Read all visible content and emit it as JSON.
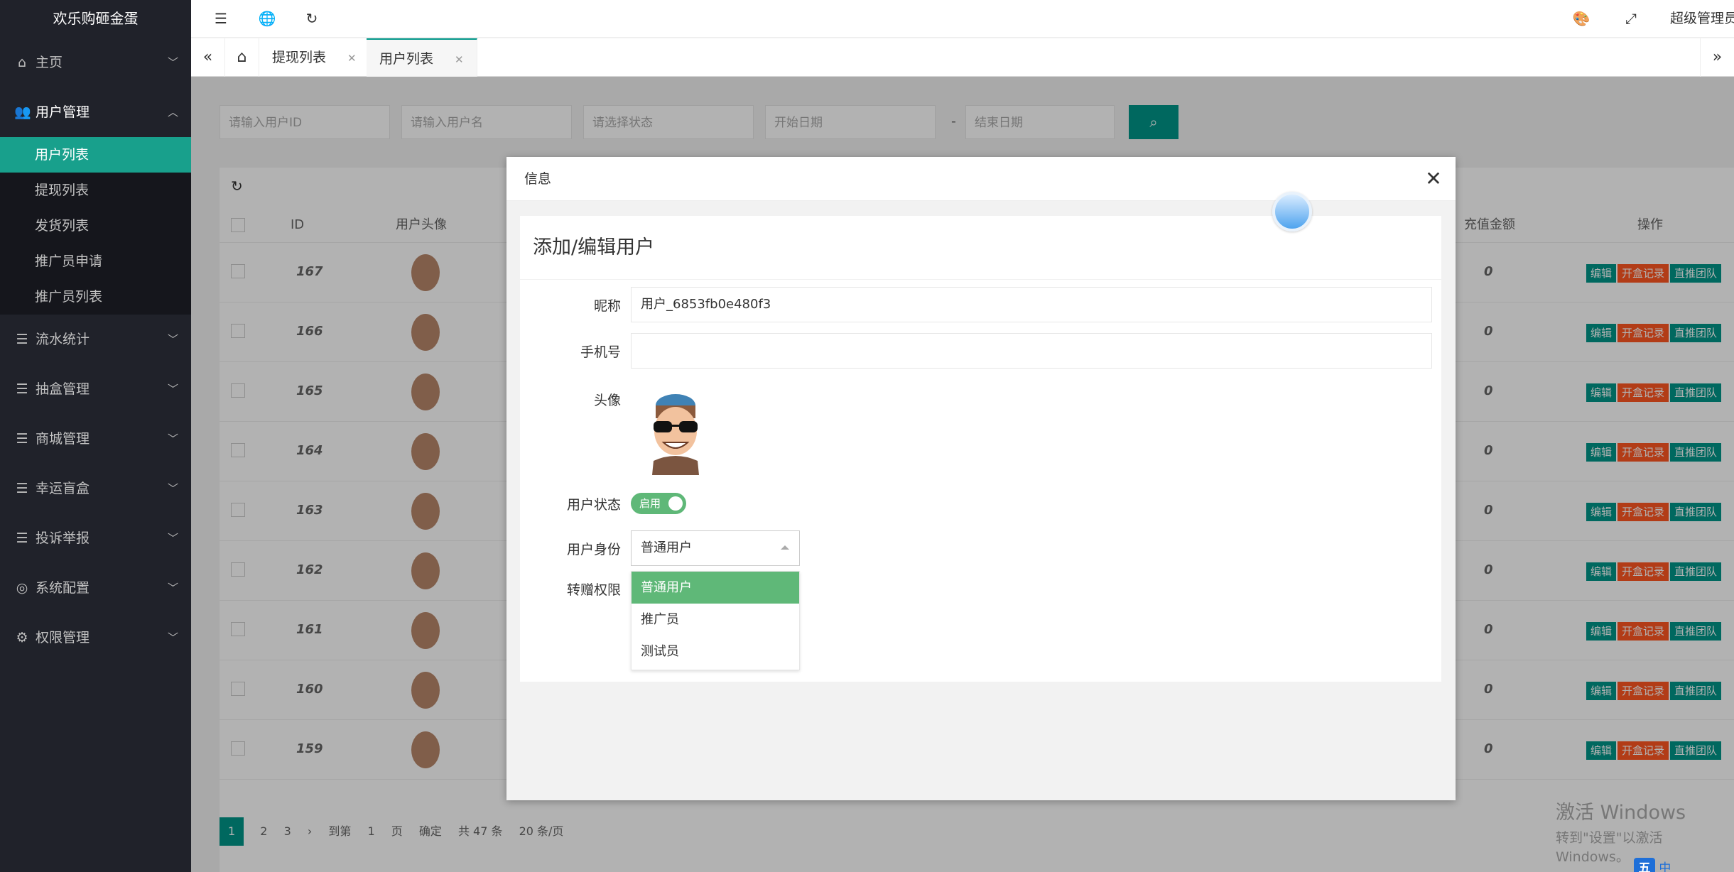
{
  "app": {
    "logo": "欢乐购砸金蛋",
    "admin": "超级管理员"
  },
  "sidebar": {
    "groups": [
      {
        "label": "主页",
        "icon": "home-icon"
      },
      {
        "label": "用户管理",
        "icon": "users-icon"
      },
      {
        "label": "流水统计",
        "icon": "list-icon"
      },
      {
        "label": "抽盒管理",
        "icon": "list-icon"
      },
      {
        "label": "商城管理",
        "icon": "list-icon"
      },
      {
        "label": "幸运盲盒",
        "icon": "list-icon"
      },
      {
        "label": "投诉举报",
        "icon": "list-icon"
      },
      {
        "label": "系统配置",
        "icon": "settings-icon"
      },
      {
        "label": "权限管理",
        "icon": "gear-icon"
      }
    ],
    "sub_items": [
      "用户列表",
      "提现列表",
      "发货列表",
      "推广员申请",
      "推广员列表"
    ]
  },
  "tabs": [
    {
      "label": "提现列表"
    },
    {
      "label": "用户列表"
    }
  ],
  "search": {
    "user_id": "请输入用户ID",
    "user_name": "请输入用户名",
    "status": "请选择状态",
    "start_date": "开始日期",
    "sep": "-",
    "end_date": "结束日期"
  },
  "table": {
    "headers": {
      "id": "ID",
      "avatar": "用户头像",
      "amount": "充值金额",
      "ops": "操作"
    },
    "rows": [
      {
        "id": "167",
        "amount": "0"
      },
      {
        "id": "166",
        "amount": "0"
      },
      {
        "id": "165",
        "amount": "0"
      },
      {
        "id": "164",
        "amount": "0"
      },
      {
        "id": "163",
        "amount": "0"
      },
      {
        "id": "162",
        "amount": "0"
      },
      {
        "id": "161",
        "amount": "0"
      },
      {
        "id": "160",
        "amount": "0"
      },
      {
        "id": "159",
        "amount": "0"
      }
    ],
    "op_labels": {
      "edit": "编辑",
      "records": "开盒记录",
      "team": "直推团队"
    }
  },
  "pager": {
    "p1": "1",
    "p2": "2",
    "p3": "3",
    "goto": "到第",
    "page_input": "1",
    "page_unit": "页",
    "confirm": "确定",
    "total": "共 47 条",
    "size": "20 条/页"
  },
  "modal": {
    "title": "信息",
    "form_title": "添加/编辑用户",
    "fields": {
      "nickname_label": "昵称",
      "nickname_value": "用户_6853fb0e480f3",
      "phone_label": "手机号",
      "phone_value": "",
      "avatar_label": "头像",
      "status_label": "用户状态",
      "status_value": "启用",
      "identity_label": "用户身份",
      "identity_value": "普通用户",
      "transfer_label": "转赠权限"
    },
    "identity_options": [
      "普通用户",
      "推广员",
      "测试员"
    ]
  },
  "watermark": {
    "line1": "激活 Windows",
    "line2": "转到\"设置\"以激活 Windows。"
  },
  "ime": {
    "label": "中"
  },
  "colors": {
    "primary": "#009688",
    "switch": "#5fb878",
    "danger": "#ff5722",
    "sidebar": "#20222a"
  }
}
